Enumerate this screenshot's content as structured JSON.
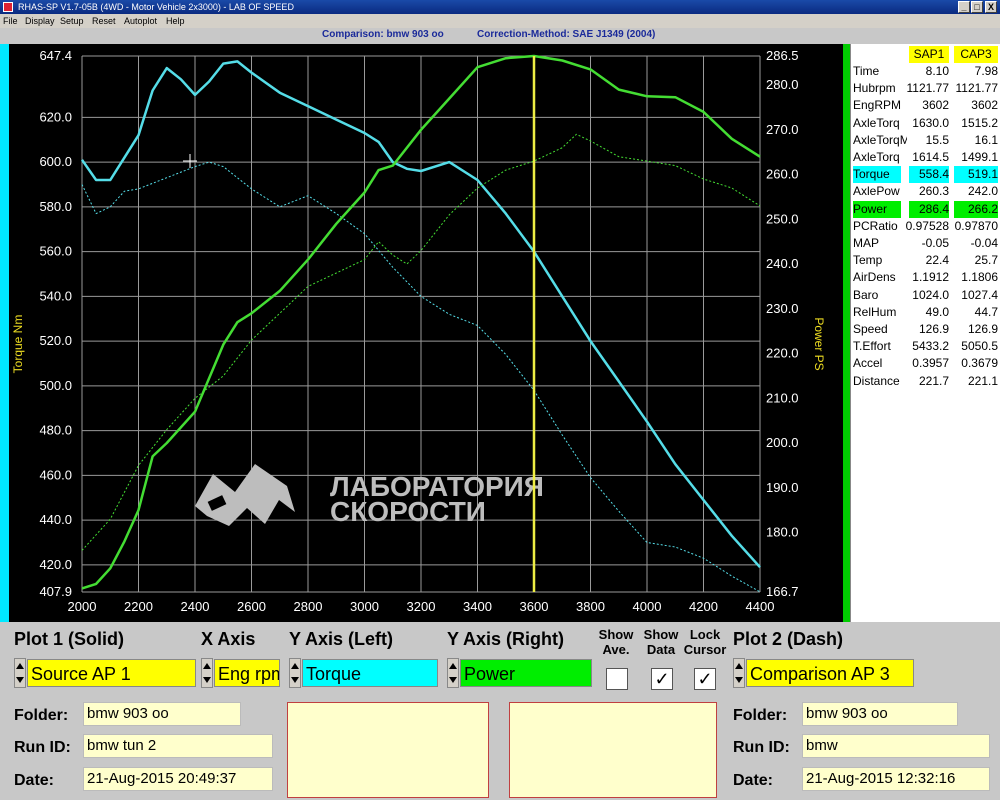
{
  "window": {
    "title": "RHAS-SP V1.7-05B  (4WD - Motor Vehicle 2x3000) - LAB OF SPEED",
    "min_label": "_",
    "max_label": "□",
    "close_label": "X"
  },
  "menu": [
    "File",
    "Display",
    "Setup",
    "Reset",
    "Autoplot",
    "Help"
  ],
  "header": {
    "comparison": "Comparison: bmw 903 oo",
    "correction": "Correction-Method: SAE J1349 (2004)"
  },
  "colors": {
    "torque": "#55dde8",
    "power": "#44dd33",
    "cursor": "#eeee44",
    "label": "#eedd22",
    "source_bg": "#ffff00",
    "torque_bg": "#00ffff",
    "power_bg": "#00ee00"
  },
  "chart_data": {
    "type": "line",
    "xlabel": "",
    "ylabel_left": "Torque Nm",
    "ylabel_right": "Power PS",
    "x_ticks": [
      "2000",
      "2200",
      "2400",
      "2600",
      "2800",
      "3000",
      "3200",
      "3400",
      "3600",
      "3800",
      "4000",
      "4200",
      "4400"
    ],
    "y_left_ticks": [
      "647.4",
      "620.0",
      "600.0",
      "580.0",
      "560.0",
      "540.0",
      "520.0",
      "500.0",
      "480.0",
      "460.0",
      "440.0",
      "420.0",
      "407.9"
    ],
    "y_right_ticks": [
      "286.5",
      "280.0",
      "270.0",
      "260.0",
      "250.0",
      "240.0",
      "230.0",
      "220.0",
      "210.0",
      "200.0",
      "190.0",
      "180.0",
      "166.7"
    ],
    "xlim": [
      2000,
      4400
    ],
    "ylim_left": [
      407.9,
      647.4
    ],
    "ylim_right": [
      166.7,
      286.5
    ],
    "cursor_x": 3600,
    "series": [
      {
        "axis": "left",
        "style": "solid",
        "x": [
          2000,
          2050,
          2100,
          2200,
          2250,
          2300,
          2350,
          2400,
          2450,
          2500,
          2550,
          2600,
          2700,
          2800,
          2900,
          3000,
          3050,
          3100,
          3150,
          3200,
          3300,
          3400,
          3500,
          3600,
          3700,
          3800,
          3900,
          4000,
          4100,
          4200,
          4300,
          4400
        ],
        "y": [
          601,
          592,
          592,
          612,
          632,
          642,
          637,
          630,
          636,
          644,
          645,
          640,
          631,
          625,
          619,
          613,
          609,
          600,
          597,
          596,
          600,
          592,
          577,
          560,
          540,
          520,
          502,
          484,
          465,
          449,
          433,
          419
        ]
      },
      {
        "axis": "left",
        "style": "dash",
        "x": [
          2000,
          2050,
          2100,
          2150,
          2200,
          2300,
          2400,
          2450,
          2500,
          2600,
          2700,
          2800,
          2900,
          3000,
          3100,
          3200,
          3300,
          3400,
          3500,
          3600,
          3700,
          3800,
          3900,
          4000,
          4100,
          4200,
          4300,
          4400
        ],
        "y": [
          590,
          577,
          580,
          587,
          588,
          593,
          598,
          600,
          598,
          588,
          580,
          585,
          577,
          568,
          553,
          540,
          532,
          527,
          514,
          498,
          478,
          459,
          444,
          430,
          428,
          423,
          415,
          408
        ]
      },
      {
        "axis": "right",
        "style": "solid",
        "x": [
          2000,
          2050,
          2100,
          2150,
          2200,
          2250,
          2300,
          2400,
          2500,
          2550,
          2600,
          2700,
          2800,
          2900,
          3000,
          3050,
          3100,
          3200,
          3300,
          3400,
          3500,
          3600,
          3700,
          3800,
          3900,
          4000,
          4100,
          4200,
          4300,
          4400
        ],
        "y": [
          167.5,
          168.5,
          172,
          178,
          185,
          197,
          200,
          207,
          222,
          227,
          229,
          234,
          241,
          249,
          256,
          261,
          262,
          270,
          277,
          284,
          286,
          286.5,
          285.5,
          283.5,
          279,
          277.5,
          277.3,
          274,
          268,
          264
        ]
      },
      {
        "axis": "right",
        "style": "dash",
        "x": [
          2000,
          2100,
          2200,
          2300,
          2400,
          2500,
          2600,
          2700,
          2800,
          2900,
          3000,
          3050,
          3100,
          3150,
          3200,
          3300,
          3400,
          3500,
          3600,
          3700,
          3750,
          3800,
          3900,
          4000,
          4100,
          4200,
          4300,
          4400
        ],
        "y": [
          176,
          183,
          195,
          203,
          210,
          215,
          223,
          229,
          235,
          238,
          241,
          245,
          242,
          240,
          243,
          251,
          257,
          261,
          263,
          266,
          269,
          267.5,
          264,
          263,
          262,
          259,
          257,
          253
        ]
      }
    ],
    "watermark": [
      "ЛАБОРАТОРИЯ",
      "СКОРОСТИ"
    ]
  },
  "panel": {
    "col1": "SAP1",
    "col2": "CAP3",
    "rows": [
      {
        "label": "Time",
        "v1": "8.10",
        "v2": "7.98",
        "hl": ""
      },
      {
        "label": "Hubrpm",
        "v1": "1121.77",
        "v2": "1121.77",
        "hl": ""
      },
      {
        "label": "EngRPM",
        "v1": "3602",
        "v2": "3602",
        "hl": ""
      },
      {
        "label": "AxleTorq",
        "v1": "1630.0",
        "v2": "1515.2",
        "hl": ""
      },
      {
        "label": "AxleTorqM",
        "v1": "15.5",
        "v2": "16.1",
        "hl": ""
      },
      {
        "label": "AxleTorq",
        "v1": "1614.5",
        "v2": "1499.1",
        "hl": ""
      },
      {
        "label": "Torque",
        "v1": "558.4",
        "v2": "519.1",
        "hl": "torque"
      },
      {
        "label": "AxlePow",
        "v1": "260.3",
        "v2": "242.0",
        "hl": ""
      },
      {
        "label": "Power",
        "v1": "286.4",
        "v2": "266.2",
        "hl": "power"
      },
      {
        "label": "PCRatio",
        "v1": "0.97528",
        "v2": "0.97870",
        "hl": ""
      },
      {
        "label": "MAP",
        "v1": "-0.05",
        "v2": "-0.04",
        "hl": ""
      },
      {
        "label": "Temp",
        "v1": "22.4",
        "v2": "25.7",
        "hl": ""
      },
      {
        "label": "AirDens",
        "v1": "1.1912",
        "v2": "1.1806",
        "hl": ""
      },
      {
        "label": "Baro",
        "v1": "1024.0",
        "v2": "1027.4",
        "hl": ""
      },
      {
        "label": "RelHum",
        "v1": "49.0",
        "v2": "44.7",
        "hl": ""
      },
      {
        "label": "Speed",
        "v1": "126.9",
        "v2": "126.9",
        "hl": ""
      },
      {
        "label": "T.Effort",
        "v1": "5433.2",
        "v2": "5050.5",
        "hl": ""
      },
      {
        "label": "Accel",
        "v1": "0.3957",
        "v2": "0.3679",
        "hl": ""
      },
      {
        "label": "Distance",
        "v1": "221.7",
        "v2": "221.1",
        "hl": ""
      }
    ]
  },
  "controls": {
    "plot1_label": "Plot 1 (Solid)",
    "xaxis_label": "X Axis",
    "yleft_label": "Y Axis (Left)",
    "yright_label": "Y Axis (Right)",
    "show_ave_label": "Show Ave.",
    "show_data_label": "Show Data",
    "lock_cursor_label": "Lock Cursor",
    "plot2_label": "Plot 2 (Dash)",
    "plot1_value": "Source AP 1",
    "xaxis_value": "Eng rpm",
    "yleft_value": "Torque",
    "yright_value": "Power",
    "plot2_value": "Comparison AP 3",
    "show_ave_checked": "",
    "show_data_checked": "✓",
    "lock_cursor_checked": "✓",
    "folder_label": "Folder:",
    "runid_label": "Run ID:",
    "date_label": "Date:",
    "left_folder": "bmw 903 oo",
    "left_runid": "bmw tun 2",
    "left_date": "21-Aug-2015  20:49:37",
    "right_folder": "bmw 903 oo",
    "right_runid": "bmw",
    "right_date": "21-Aug-2015  12:32:16"
  }
}
